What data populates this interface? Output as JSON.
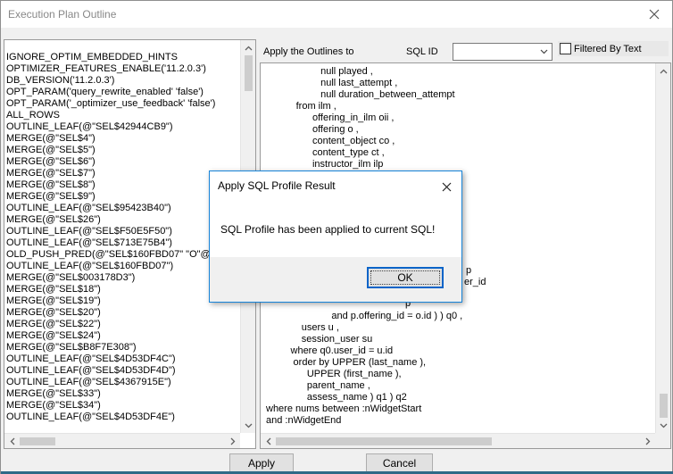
{
  "window": {
    "title": "Execution Plan Outline"
  },
  "toolbar": {
    "apply_outlines_label": "Apply the Outlines to",
    "sql_id_label": "SQL ID",
    "sql_id_value": "",
    "filtered_by_text_label": "Filtered By Text",
    "filtered_by_text_checked": false
  },
  "outline_hints": [
    "IGNORE_OPTIM_EMBEDDED_HINTS",
    "OPTIMIZER_FEATURES_ENABLE('11.2.0.3')",
    "DB_VERSION('11.2.0.3')",
    "OPT_PARAM('query_rewrite_enabled' 'false')",
    "OPT_PARAM('_optimizer_use_feedback' 'false')",
    "ALL_ROWS",
    "OUTLINE_LEAF(@\"SEL$42944CB9\")",
    "MERGE(@\"SEL$4\")",
    "MERGE(@\"SEL$5\")",
    "MERGE(@\"SEL$6\")",
    "MERGE(@\"SEL$7\")",
    "MERGE(@\"SEL$8\")",
    "MERGE(@\"SEL$9\")",
    "OUTLINE_LEAF(@\"SEL$95423B40\")",
    "MERGE(@\"SEL$26\")",
    "OUTLINE_LEAF(@\"SEL$F50E5F50\")",
    "OUTLINE_LEAF(@\"SEL$713E75B4\")",
    "OLD_PUSH_PRED(@\"SEL$160FBD07\" \"O\"@\"SEL",
    "OUTLINE_LEAF(@\"SEL$160FBD07\")",
    "MERGE(@\"SEL$003178D3\")",
    "MERGE(@\"SEL$18\")",
    "MERGE(@\"SEL$19\")",
    "MERGE(@\"SEL$20\")",
    "MERGE(@\"SEL$22\")",
    "MERGE(@\"SEL$24\")",
    "MERGE(@\"SEL$B8F7E308\")",
    "OUTLINE_LEAF(@\"SEL$4D53DF4C\")",
    "OUTLINE_LEAF(@\"SEL$4D53DF4D\")",
    "OUTLINE_LEAF(@\"SEL$4367915E\")",
    "MERGE(@\"SEL$33\")",
    "MERGE(@\"SEL$34\")",
    "OUTLINE_LEAF(@\"SEL$4D53DF4E\")"
  ],
  "sql_text_top": [
    "                    null played ,",
    "                    null last_attempt ,",
    "                    null duration_between_attempt",
    "           from ilm ,",
    "                 offering_in_ilm oii ,",
    "                 offering o ,",
    "                 content_object co ,",
    "                 content_type ct ,",
    "                 instructor_ilm ilp"
  ],
  "sql_text_fragments": [
    "p",
    "er_id",
    "p"
  ],
  "sql_text_bottom": [
    "                        and p.offering_id = o.id ) ) q0 ,",
    "             users u ,",
    "             session_user su",
    "         where q0.user_id = u.id",
    "          order by UPPER (last_name ),",
    "               UPPER (first_name ),",
    "               parent_name ,",
    "               assess_name ) q1 ) q2",
    "where nums between :nWidgetStart",
    "and :nWidgetEnd"
  ],
  "buttons": {
    "apply": "Apply",
    "cancel": "Cancel"
  },
  "dialog": {
    "title": "Apply SQL Profile Result",
    "message": "SQL Profile has been applied to current SQL!",
    "ok": "OK"
  }
}
